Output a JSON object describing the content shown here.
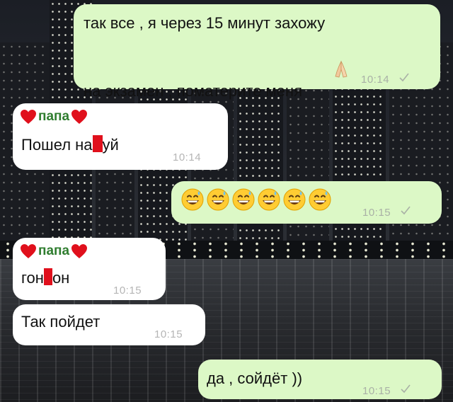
{
  "messages": {
    "m1": {
      "lines": [
        "так все , я через 15 минут захожу",
        "на экзамен , поматерите меня"
      ],
      "time": "10:14",
      "status_icon": "check-icon"
    },
    "m2": {
      "sender": "папа",
      "text_before": "Пошел на",
      "text_after": "уй",
      "time": "10:14"
    },
    "m3": {
      "emoji": [
        "grinning-sweat",
        "grinning-sweat",
        "grinning-sweat",
        "grinning-sweat",
        "grinning-sweat",
        "grinning-sweat"
      ],
      "time": "10:15",
      "status_icon": "check-icon"
    },
    "m4": {
      "sender": "папа",
      "text_before": "гон",
      "text_after": "он",
      "time": "10:15"
    },
    "m5": {
      "text": "Так пойдет",
      "time": "10:15"
    },
    "m6": {
      "text": "да , сойдёт ))",
      "time": "10:15",
      "status_icon": "check-icon"
    }
  },
  "colors": {
    "outgoing_bubble": "#dcf8c6",
    "incoming_bubble": "#ffffff",
    "sender_name": "#2f7d2f",
    "heart": "#e0101c",
    "censor_bar": "#e0101c"
  }
}
